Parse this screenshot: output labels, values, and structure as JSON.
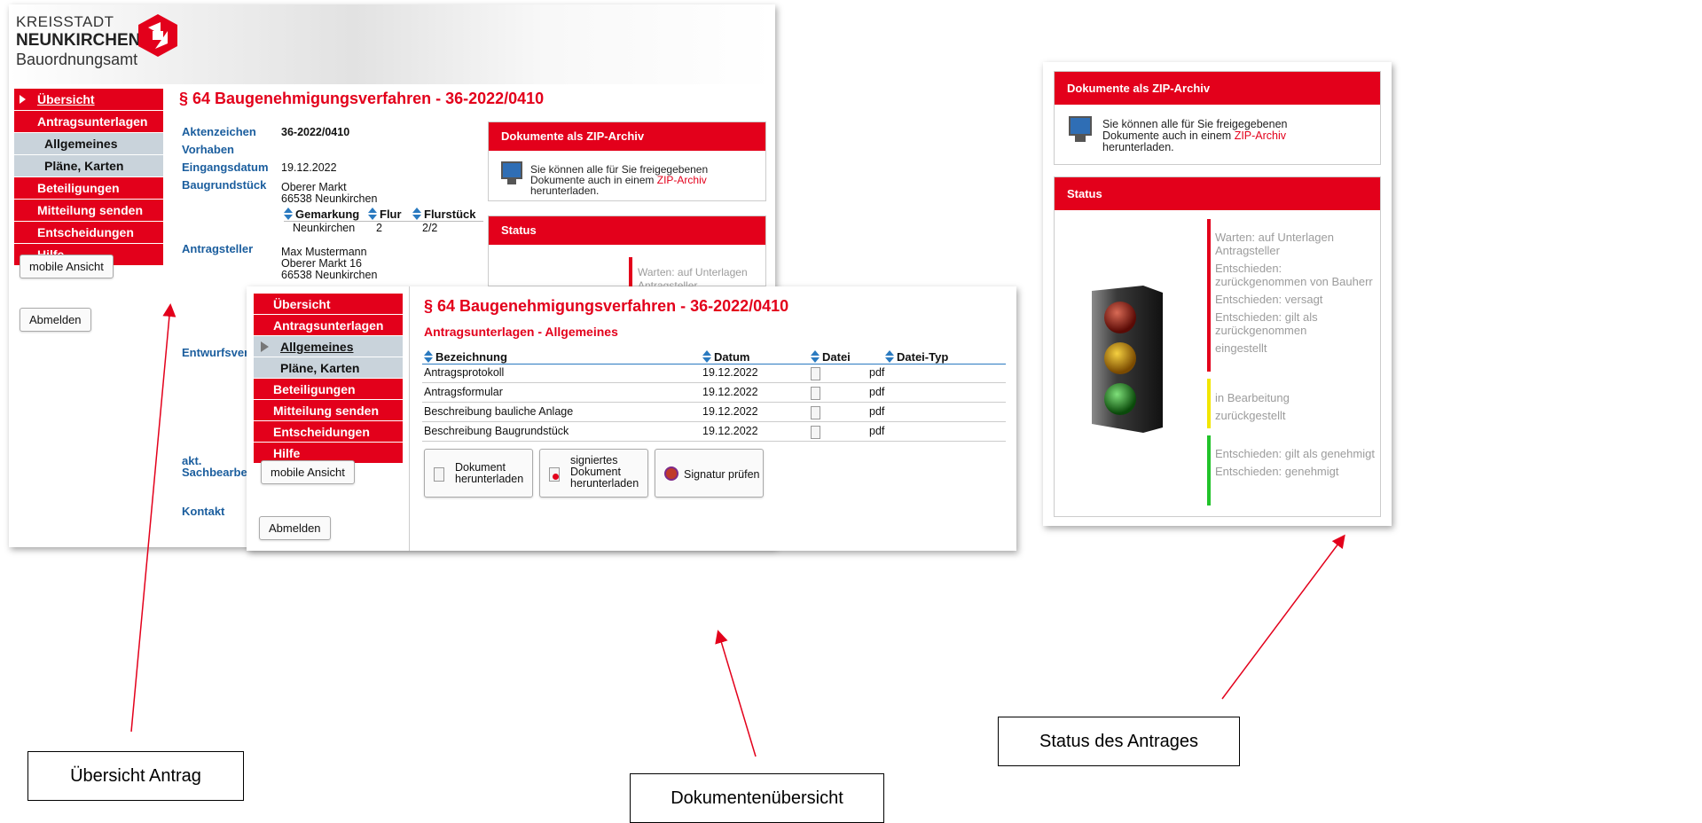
{
  "logo": {
    "line1": "KREISSTADT",
    "line2": "NEUNKIRCHEN",
    "line3": "Bauordnungsamt"
  },
  "nav": {
    "items": [
      {
        "label": "Übersicht"
      },
      {
        "label": "Antragsunterlagen"
      },
      {
        "label": "Allgemeines"
      },
      {
        "label": "Pläne, Karten"
      },
      {
        "label": "Beteiligungen"
      },
      {
        "label": "Mitteilung senden"
      },
      {
        "label": "Entscheidungen"
      },
      {
        "label": "Hilfe"
      }
    ],
    "mobile_label": "mobile Ansicht",
    "logout_label": "Abmelden"
  },
  "main": {
    "title": "§ 64 Baugenehmigungsverfahren - 36-2022/0410",
    "aktenzeichen_label": "Aktenzeichen",
    "aktenzeichen": "36-2022/0410",
    "vorhaben_label": "Vorhaben",
    "eingang_label": "Eingangsdatum",
    "eingang": "19.12.2022",
    "grund_label": "Baugrundstück",
    "grund_l1": "Oberer Markt",
    "grund_l2": "66538 Neunkirchen",
    "gemarkung_h": "Gemarkung",
    "flur_h": "Flur",
    "flurstueck_h": "Flurstück",
    "gemarkung": "Neunkirchen",
    "flur": "2",
    "flurstueck": "2/2",
    "antragsteller_label": "Antragsteller",
    "ast_l1": "Max Mustermann",
    "ast_l2": "Oberer Markt 16",
    "ast_l3": "66538 Neunkirchen",
    "entwurf_label": "Entwurfsverf",
    "sach_label_1": "akt.",
    "sach_label_2": "Sachbearbei",
    "kontakt_label": "Kontakt"
  },
  "zip": {
    "header": "Dokumente als ZIP-Archiv",
    "text_1": "Sie können alle für Sie freigegebenen",
    "text_2a": "Dokumente auch in einem ",
    "text_2b": "ZIP-Archiv",
    "text_3": "herunterladen."
  },
  "status": {
    "header": "Status",
    "red_items": [
      "Warten: auf Unterlagen Antragsteller",
      "Entschieden: zurückgenommen von Bauherr",
      "Entschieden: versagt",
      "Entschieden: gilt als zurückgenommen",
      "eingestellt"
    ],
    "yellow_items": [
      "in Bearbeitung",
      "zurückgestellt"
    ],
    "green_items": [
      "Entschieden: gilt als genehmigt",
      "Entschieden: genehmigt"
    ],
    "clip_1": "Warten: auf Unterlagen",
    "clip_2": "Antragsteller",
    "colors": {
      "red": "#e3001b",
      "yellow": "#f2e600",
      "green": "#22c32a"
    }
  },
  "docs": {
    "subtitle": "Antragsunterlagen - Allgemeines",
    "headers": [
      "Bezeichnung",
      "Datum",
      "Datei",
      "Datei-Typ"
    ],
    "rows": [
      {
        "name": "Antragsprotokoll",
        "date": "19.12.2022",
        "type": "pdf"
      },
      {
        "name": "Antragsformular",
        "date": "19.12.2022",
        "type": "pdf"
      },
      {
        "name": "Beschreibung bauliche Anlage",
        "date": "19.12.2022",
        "type": "pdf"
      },
      {
        "name": "Beschreibung Baugrundstück",
        "date": "19.12.2022",
        "type": "pdf"
      }
    ],
    "btn_download_1": "Dokument",
    "btn_download_2": "herunterladen",
    "btn_signed_1": "signiertes",
    "btn_signed_2": "Dokument",
    "btn_signed_3": "herunterladen",
    "btn_verify": "Signatur prüfen"
  },
  "callouts": {
    "overview": "Übersicht Antrag",
    "documents": "Dokumentenübersicht",
    "status": "Status des Antrages"
  }
}
